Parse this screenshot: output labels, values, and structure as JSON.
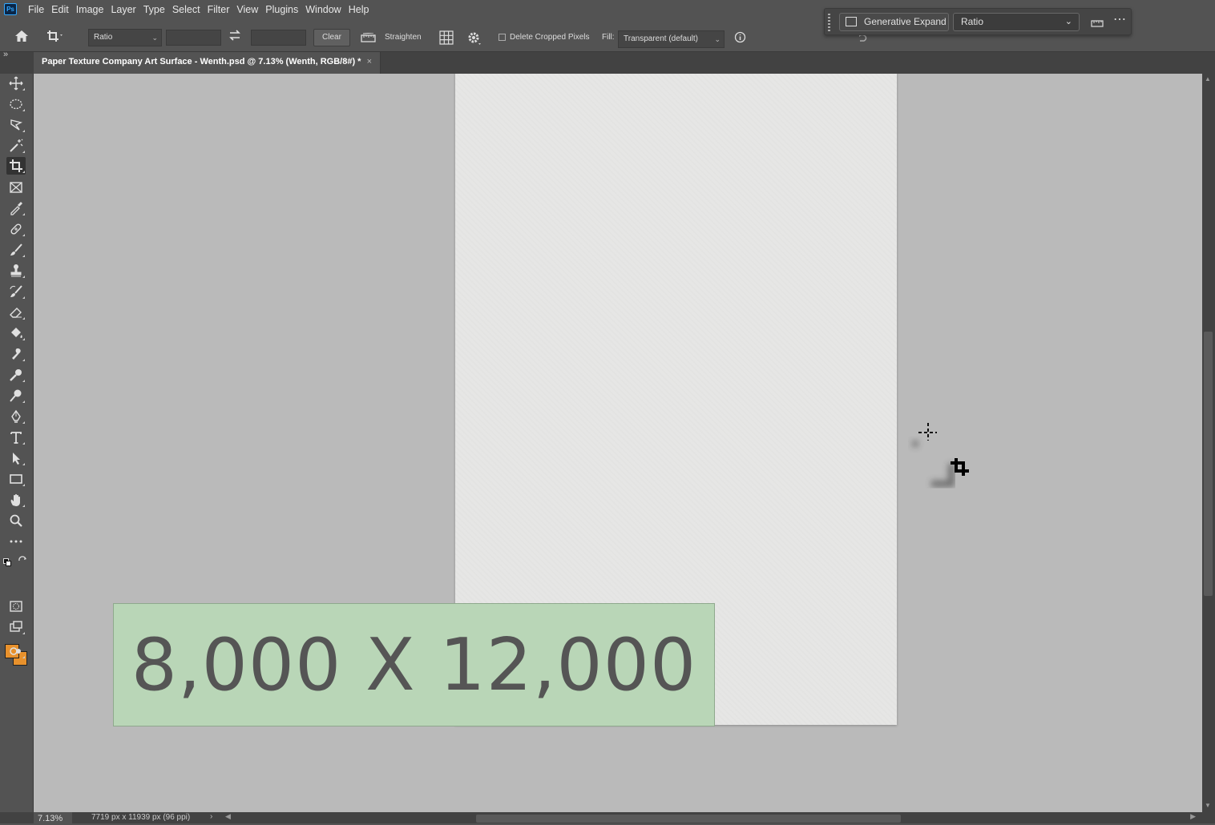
{
  "app": {
    "logo": "Ps"
  },
  "menu": [
    "File",
    "Edit",
    "Image",
    "Layer",
    "Type",
    "Select",
    "Filter",
    "View",
    "Plugins",
    "Window",
    "Help"
  ],
  "options": {
    "ratio_select": "Ratio",
    "width_value": "",
    "height_value": "",
    "clear_label": "Clear",
    "straighten_label": "Straighten",
    "delete_cropped_label": "Delete Cropped Pixels",
    "delete_cropped_checked": false,
    "fill_label": "Fill:",
    "fill_select": "Transparent (default)"
  },
  "contextbar": {
    "generative_expand_label": "Generative Expand",
    "ratio_select": "Ratio"
  },
  "document": {
    "tab_title": "Paper Texture Company Art Surface - Wenth.psd @ 7.13% (Wenth, RGB/8#) *",
    "close_glyph": "×"
  },
  "tools": [
    "move-tool",
    "marquee-tool",
    "lasso-tool",
    "magic-wand-tool",
    "crop-tool",
    "frame-tool",
    "eyedropper-tool",
    "healing-brush-tool",
    "brush-tool",
    "stamp-tool",
    "history-brush-tool",
    "eraser-tool",
    "paint-bucket-tool",
    "smudge-tool",
    "dodge-tool",
    "burn-tool",
    "pen-tool",
    "type-tool",
    "path-selection-tool",
    "rectangle-tool",
    "hand-tool",
    "zoom-tool",
    "more-tools"
  ],
  "colors": {
    "foreground": "#e8912c",
    "background": "#e8912c",
    "banner": "#b9d6b7"
  },
  "overlay": {
    "dimensions_text": "8,000 X 12,000"
  },
  "status": {
    "zoom": "7.13%",
    "doc_info": "7719 px x 11939 px (96 ppi)",
    "arrow": "›"
  }
}
